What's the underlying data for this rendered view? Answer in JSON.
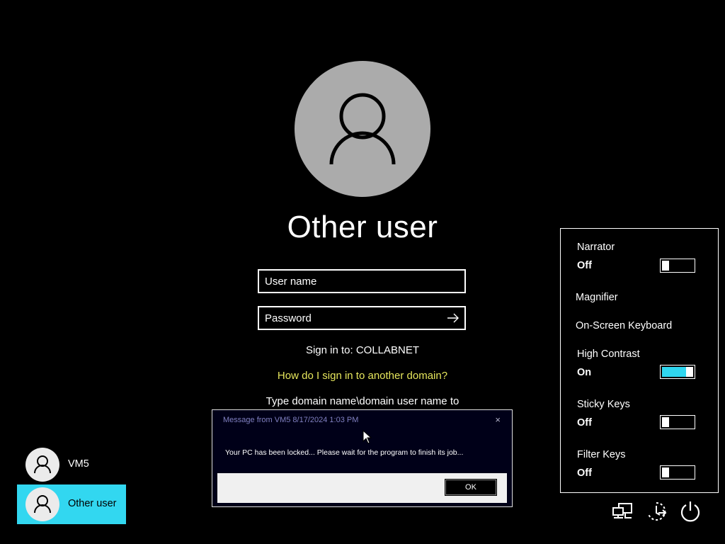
{
  "login": {
    "user_title": "Other user",
    "username_placeholder": "User name",
    "password_placeholder": "Password",
    "sign_in_to": "Sign in to: COLLABNET",
    "domain_link": "How do I sign in to another domain?",
    "domain_hint": "Type domain name\\domain user name to"
  },
  "message": {
    "title": "Message from VM5 8/17/2024 1:03 PM",
    "close": "×",
    "body": "Your PC has been locked... Please wait for the program to finish its job...",
    "ok_label": "OK"
  },
  "ease": {
    "narrator": {
      "label": "Narrator",
      "state": "Off",
      "on": false
    },
    "magnifier": {
      "label": "Magnifier"
    },
    "osk": {
      "label": "On-Screen Keyboard"
    },
    "high_contrast": {
      "label": "High Contrast",
      "state": "On",
      "on": true
    },
    "sticky_keys": {
      "label": "Sticky Keys",
      "state": "Off",
      "on": false
    },
    "filter_keys": {
      "label": "Filter Keys",
      "state": "Off",
      "on": false
    }
  },
  "users": [
    {
      "name": "VM5",
      "selected": false
    },
    {
      "name": "Other user",
      "selected": true
    }
  ],
  "system_icons": [
    "network-icon",
    "ease-of-access-icon",
    "power-icon"
  ],
  "colors": {
    "background": "#000000",
    "selection": "#32d7f0",
    "link": "#e6e65c",
    "toggle_on": "#2fd6ef",
    "avatar": "#ababab"
  }
}
